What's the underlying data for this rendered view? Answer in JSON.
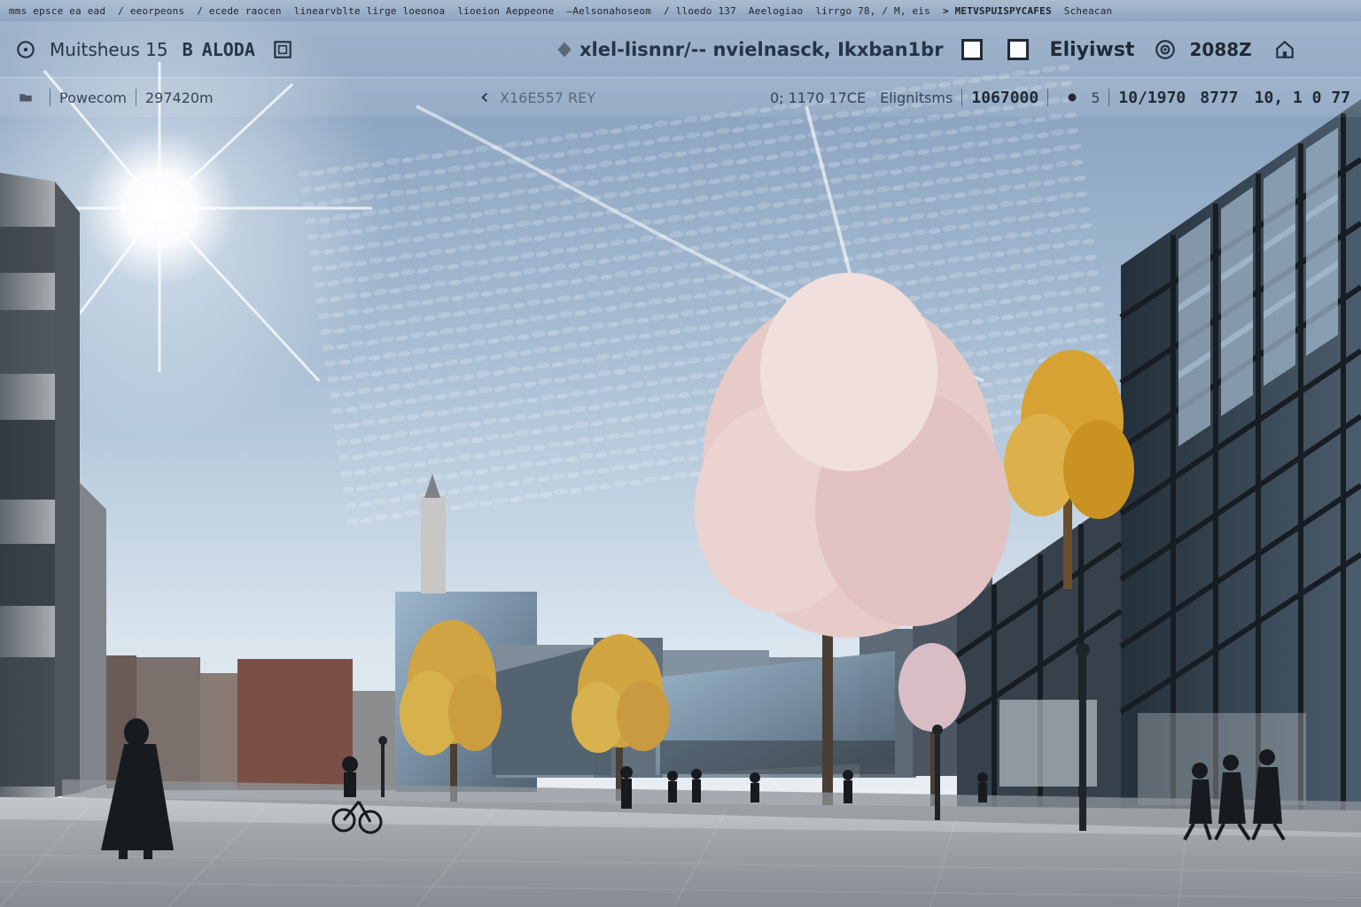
{
  "ticker": {
    "segments": [
      "mms epsce ea ead",
      "/ eeorpeons",
      "/ ecede raocen",
      "linearvblte lirge loeonoa",
      "lioeion Aeppeone",
      "—Aelsonahoseom",
      "/ lloedo 137",
      "Aeelogiao",
      "lirrgo 78, / M, eis",
      "> METVSPUISPYCAFES",
      "Scheacan"
    ]
  },
  "toolbar": {
    "app_label": "Muitsheus 15",
    "left_badge": "B",
    "left_text": "ALODA",
    "center_text": "xlel-lisnnr/-- nvielnasck, Ikxban1br",
    "action_text": "Eliyiwst",
    "action_number": "2088Z"
  },
  "statusbar": {
    "left_label": "Powecom",
    "left_value": "297420m",
    "center_code": "X16E557 REY",
    "mid_label": "0; 1170 17CE",
    "mid_label2": "Elignitsms",
    "number_1": "1067000",
    "number_2": "10/1970",
    "number_3": "8777",
    "number_4": "10, 1 0 77",
    "number_small": "5"
  },
  "icons": {
    "toolbar_left": "settings-ring-icon",
    "toolbar_box": "square-frame-icon",
    "toolbar_center": "diamond-icon",
    "toolbar_target": "target-icon",
    "toolbar_home": "home-icon",
    "status_folder": "folder-icon",
    "status_arrow": "arrow-left-icon",
    "status_dot": "dot-icon"
  },
  "colors": {
    "sky_top": "#7f99b8",
    "sky_bottom": "#dbe6ef",
    "street": "#a4aaae",
    "shadow": "#596168",
    "glass_dark": "#262d34",
    "glass_light": "#9db4c8",
    "tree_pink": "#e7cbc9",
    "tree_gold": "#d4a63f",
    "overlay_text": "#202a35"
  }
}
